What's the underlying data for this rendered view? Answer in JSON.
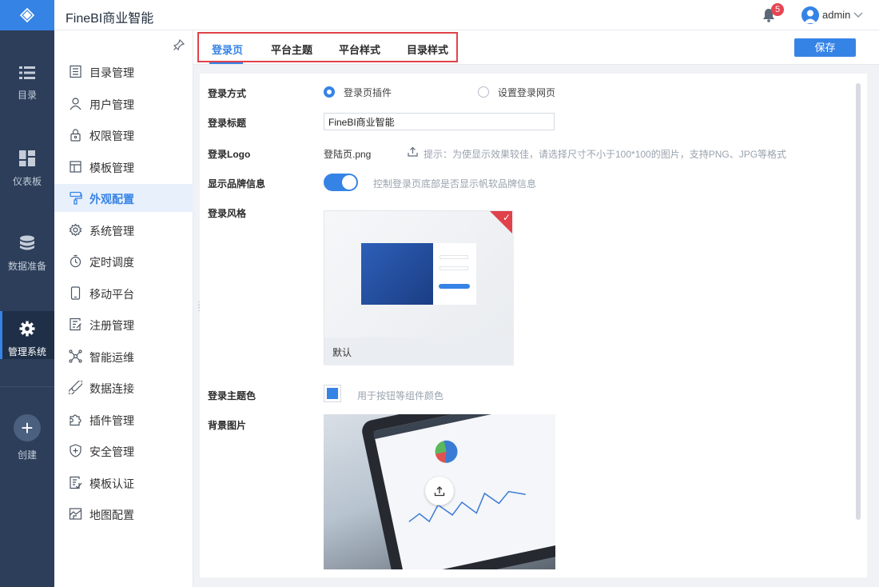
{
  "app": {
    "title": "FineBI商业智能"
  },
  "header": {
    "notification_count": "5",
    "user_name": "admin"
  },
  "rail": {
    "items": [
      {
        "label": "目录",
        "icon": "list-icon"
      },
      {
        "label": "仪表板",
        "icon": "dashboard-icon"
      },
      {
        "label": "数据准备",
        "icon": "database-icon"
      },
      {
        "label": "管理系统",
        "icon": "gear-icon",
        "active": true
      },
      {
        "label": "创建",
        "icon": "plus-icon"
      }
    ]
  },
  "subnav": {
    "items": [
      {
        "label": "目录管理",
        "icon": "catalog-icon"
      },
      {
        "label": "用户管理",
        "icon": "user-icon"
      },
      {
        "label": "权限管理",
        "icon": "lock-icon"
      },
      {
        "label": "模板管理",
        "icon": "template-icon"
      },
      {
        "label": "外观配置",
        "icon": "brush-icon",
        "active": true
      },
      {
        "label": "系统管理",
        "icon": "gear-icon"
      },
      {
        "label": "定时调度",
        "icon": "timer-icon"
      },
      {
        "label": "移动平台",
        "icon": "mobile-icon"
      },
      {
        "label": "注册管理",
        "icon": "register-icon"
      },
      {
        "label": "智能运维",
        "icon": "network-icon"
      },
      {
        "label": "数据连接",
        "icon": "link-icon"
      },
      {
        "label": "插件管理",
        "icon": "puzzle-icon"
      },
      {
        "label": "安全管理",
        "icon": "shield-icon"
      },
      {
        "label": "模板认证",
        "icon": "certificate-icon"
      },
      {
        "label": "地图配置",
        "icon": "map-icon"
      }
    ]
  },
  "tabs": [
    {
      "label": "登录页",
      "active": true
    },
    {
      "label": "平台主题"
    },
    {
      "label": "平台样式"
    },
    {
      "label": "目录样式"
    }
  ],
  "toolbar": {
    "save_label": "保存"
  },
  "form": {
    "login_method": {
      "label": "登录方式",
      "options": [
        {
          "label": "登录页插件",
          "selected": true
        },
        {
          "label": "设置登录网页",
          "selected": false
        }
      ]
    },
    "login_title": {
      "label": "登录标题",
      "value": "FineBI商业智能"
    },
    "login_logo": {
      "label": "登录Logo",
      "file": "登陆页.png",
      "hint": "提示：为使显示效果较佳，请选择尺寸不小于100*100的图片，支持PNG、JPG等格式"
    },
    "brand_info": {
      "label": "显示品牌信息",
      "enabled": true,
      "hint": "控制登录页底部是否显示帆软品牌信息"
    },
    "login_style": {
      "label": "登录风格",
      "option_name": "默认",
      "selected": true
    },
    "theme_color": {
      "label": "登录主题色",
      "color": "#3683e6",
      "hint": "用于按钮等组件颜色"
    },
    "background": {
      "label": "背景图片"
    }
  },
  "colors": {
    "accent": "#3683e6",
    "rail_bg": "#2c3e5a",
    "highlight": "#e0414a"
  }
}
